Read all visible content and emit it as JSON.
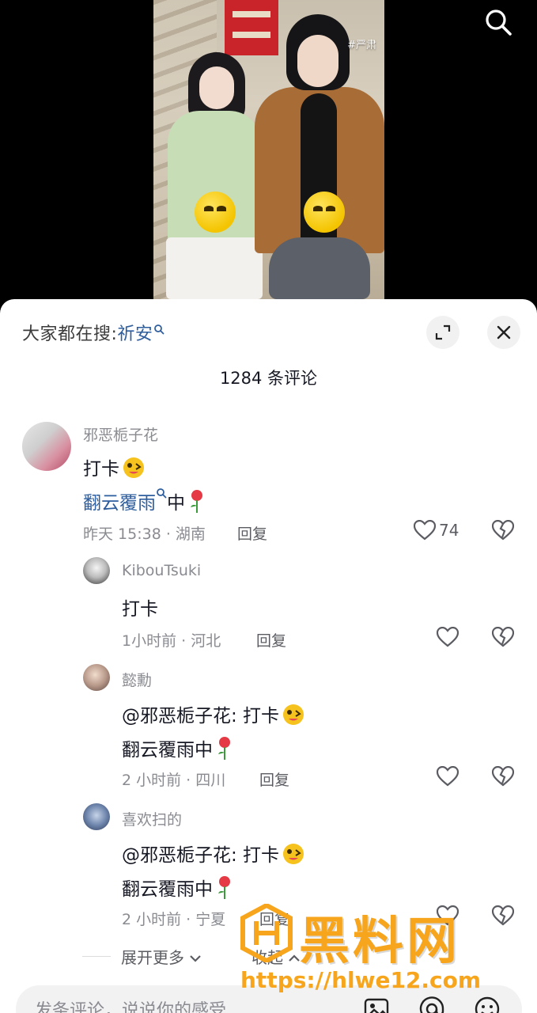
{
  "video": {
    "tag": "#严肃"
  },
  "sheet": {
    "hot_search_prefix": "大家都在搜:",
    "hot_search_term": "祈安",
    "comment_count": "1284 条评论"
  },
  "comments": [
    {
      "user": "邪恶栀子花",
      "line1": "打卡",
      "line2_link": "翻云覆雨",
      "line2_rest": "中",
      "meta": "昨天 15:38 · 湖南",
      "reply": "回复",
      "likes": "74"
    },
    {
      "user": "KibouTsuki",
      "line1": "打卡",
      "meta": "1小时前 · 河北",
      "reply": "回复"
    },
    {
      "user": "懿勳",
      "line1": "@邪恶栀子花: 打卡",
      "line2": "翻云覆雨中",
      "meta": "2 小时前 · 四川",
      "reply": "回复"
    },
    {
      "user": "喜欢扫的",
      "line1": "@邪恶栀子花: 打卡",
      "line2": "翻云覆雨中",
      "meta": "2 小时前 · 宁夏",
      "reply": "回复"
    }
  ],
  "more": {
    "expand": "展开更多",
    "collapse": "收起"
  },
  "input": {
    "placeholder": "发条评论，说说你的感受"
  },
  "watermark": {
    "title": "黑料网",
    "url": "https://hlwe12.com"
  },
  "colors": {
    "link": "#2e5e9e",
    "meta": "#8a8b91",
    "watermark": "#f7a51c"
  }
}
